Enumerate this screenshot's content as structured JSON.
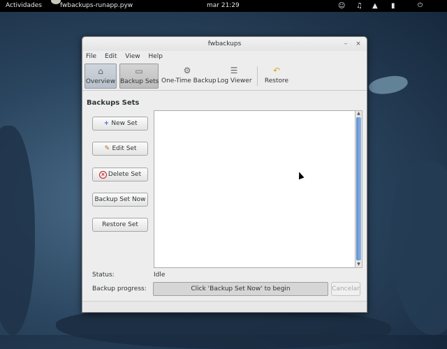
{
  "topbar": {
    "activities": "Actividades",
    "app_name": "fwbackups-runapp.pyw",
    "clock": "mar 21:29",
    "tray_icons": [
      "accessibility-icon",
      "volume-icon",
      "network-icon",
      "battery-icon"
    ],
    "user": "⏻"
  },
  "window": {
    "title": "fwbackups",
    "minimize": "–",
    "close": "×"
  },
  "menu": [
    "File",
    "Edit",
    "View",
    "Help"
  ],
  "toolbar": {
    "overview": "Overview",
    "backup_sets": "Backup Sets",
    "one_time": "One-Time Backup",
    "log_viewer": "Log Viewer",
    "restore": "Restore"
  },
  "icons": {
    "overview": "⌂",
    "backup_sets": "▭",
    "one_time": "⚙",
    "log_viewer": "☰",
    "restore": "↶",
    "new": "+",
    "edit": "✎",
    "delete": "×",
    "scroll_up": "▲",
    "scroll_down": "▼"
  },
  "main": {
    "section_title": "Backups Sets",
    "buttons": {
      "new_set": "New Set",
      "edit_set": "Edit Set",
      "delete_set": "Delete Set",
      "backup_now": "Backup Set Now",
      "restore_set": "Restore Set"
    },
    "status_label": "Status:",
    "status_value": "Idle",
    "progress_label": "Backup progress:",
    "progress_text": "Click 'Backup Set Now' to begin",
    "cancel": "Cancelar"
  }
}
